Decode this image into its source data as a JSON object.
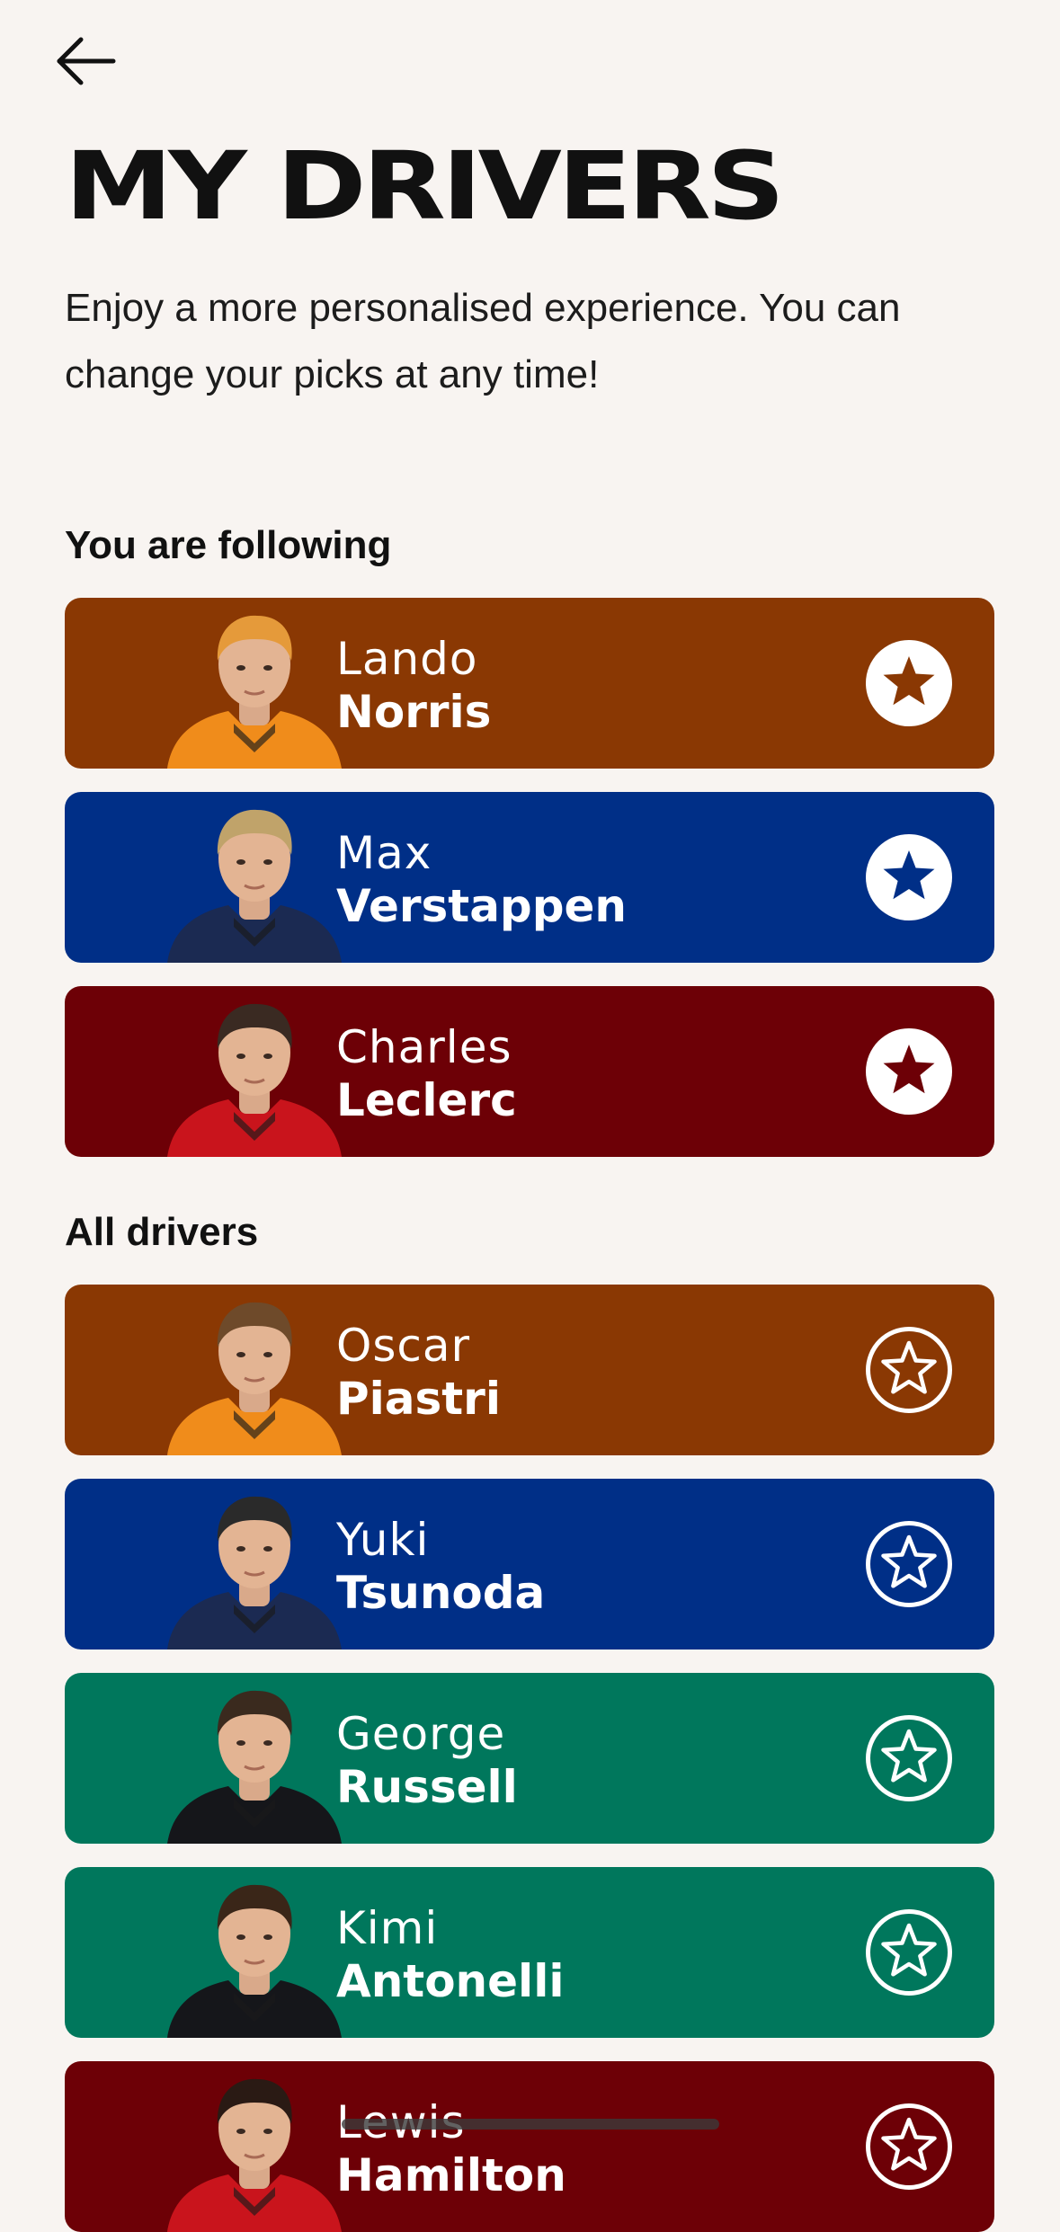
{
  "header": {
    "back_icon": "arrow-left-icon",
    "title": "MY DRIVERS",
    "intro": "Enjoy a more personalised experience. You can change your picks at any time!"
  },
  "following": {
    "label": "You are following",
    "drivers": [
      {
        "first": "Lando",
        "last": "Norris",
        "color": "#8a3803",
        "suit": "#f08c1b",
        "helmet_tone": "#e59a3a",
        "starred": true
      },
      {
        "first": "Max",
        "last": "Verstappen",
        "color": "#002f87",
        "suit": "#1b2a52",
        "helmet_tone": "#c0a36a",
        "starred": true
      },
      {
        "first": "Charles",
        "last": "Leclerc",
        "color": "#6d0006",
        "suit": "#c9141c",
        "helmet_tone": "#3a2a22",
        "starred": true
      }
    ]
  },
  "all": {
    "label": "All drivers",
    "drivers": [
      {
        "first": "Oscar",
        "last": "Piastri",
        "color": "#8a3803",
        "suit": "#f08c1b",
        "helmet_tone": "#6e4a2a",
        "starred": false
      },
      {
        "first": "Yuki",
        "last": "Tsunoda",
        "color": "#002f87",
        "suit": "#1b2a52",
        "helmet_tone": "#2a2a2a",
        "starred": false
      },
      {
        "first": "George",
        "last": "Russell",
        "color": "#00775c",
        "suit": "#15161a",
        "helmet_tone": "#3a2a1e",
        "starred": false
      },
      {
        "first": "Kimi",
        "last": "Antonelli",
        "color": "#00775c",
        "suit": "#15161a",
        "helmet_tone": "#3a2618",
        "starred": false
      },
      {
        "first": "Lewis",
        "last": "Hamilton",
        "color": "#6d0006",
        "suit": "#c9141c",
        "helmet_tone": "#2a1a14",
        "starred": false
      }
    ]
  },
  "icons": {
    "filled_star": "star-filled-icon",
    "outline_star": "star-outline-icon",
    "photo": "driver-photo"
  }
}
